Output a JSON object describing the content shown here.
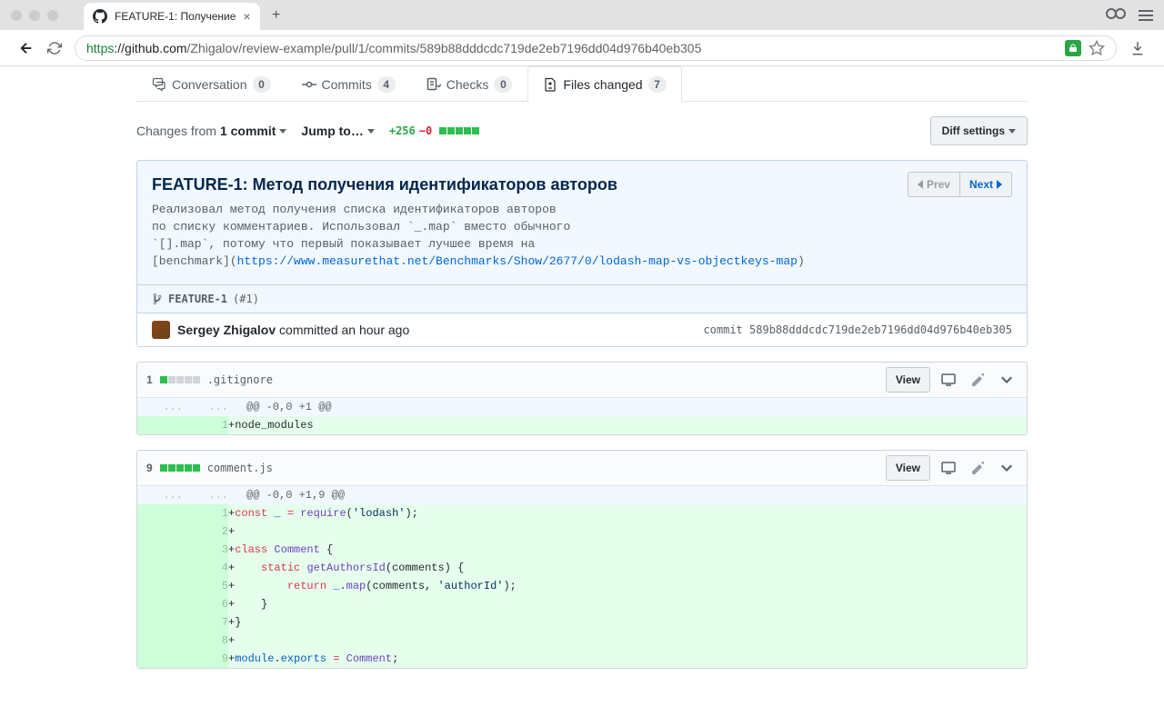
{
  "browser": {
    "tab_title": "FEATURE-1: Получение",
    "url_https": "https",
    "url_host": "://github.com",
    "url_path": "/Zhigalov/review-example/pull/1/commits/589b88dddcdc719de2eb7196dd04d976b40eb305"
  },
  "tabs": {
    "conversation": {
      "label": "Conversation",
      "count": "0"
    },
    "commits": {
      "label": "Commits",
      "count": "4"
    },
    "checks": {
      "label": "Checks",
      "count": "0"
    },
    "files": {
      "label": "Files changed",
      "count": "7"
    }
  },
  "toolbar": {
    "changes_from_prefix": "Changes from ",
    "changes_from_value": "1 commit",
    "jump_to": "Jump to…",
    "additions": "+256",
    "deletions": "−0",
    "diff_settings": "Diff settings"
  },
  "commit": {
    "title": "FEATURE-1: Метод получения идентификаторов авторов",
    "prev": "Prev",
    "next": "Next",
    "desc_line1": "Реализовал метод получения списка идентификаторов авторов",
    "desc_line2": "по списку комментариев. Использовал `_.map` вместо обычного",
    "desc_line3": "`[].map`, потому что первый показывает лучшее время на",
    "desc_line4_pre": "[benchmark](",
    "desc_link": "https://www.measurethat.net/Benchmarks/Show/2677/0/lodash-map-vs-objectkeys-map",
    "desc_line4_post": ")",
    "branch": "FEATURE-1",
    "branch_suffix": "(#1)",
    "author": "Sergey Zhigalov",
    "committed": " committed an hour ago",
    "sha_label": "commit ",
    "sha": "589b88dddcdc719de2eb7196dd04d976b40eb305"
  },
  "files": [
    {
      "count": "1",
      "blocks_added": 1,
      "name": ".gitignore",
      "view": "View",
      "hunk": "@@ -0,0 +1 @@",
      "lines": [
        {
          "n": "1",
          "html": "+node_modules"
        }
      ]
    },
    {
      "count": "9",
      "blocks_added": 5,
      "name": "comment.js",
      "view": "View",
      "hunk": "@@ -0,0 +1,9 @@",
      "lines": [
        {
          "n": "1",
          "html": "+<span class=\"pl-k\">const</span> <span class=\"pl-c1\">_</span> <span class=\"pl-k\">=</span> <span class=\"pl-en\">require</span>(<span class=\"pl-s\">'lodash'</span>);"
        },
        {
          "n": "2",
          "html": "+"
        },
        {
          "n": "3",
          "html": "+<span class=\"pl-k\">class</span> <span class=\"pl-en\">Comment</span> {"
        },
        {
          "n": "4",
          "html": "+    <span class=\"pl-k\">static</span> <span class=\"pl-en\">getAuthorsId</span>(comments) {"
        },
        {
          "n": "5",
          "html": "+        <span class=\"pl-k\">return</span> <span class=\"pl-c1\">_</span>.<span class=\"pl-en\">map</span>(comments, <span class=\"pl-s\">'authorId'</span>);"
        },
        {
          "n": "6",
          "html": "+    }"
        },
        {
          "n": "7",
          "html": "+}"
        },
        {
          "n": "8",
          "html": "+"
        },
        {
          "n": "9",
          "html": "+<span class=\"pl-c1\">module</span>.<span class=\"pl-c1\">exports</span> <span class=\"pl-k\">=</span> <span class=\"pl-en\">Comment</span>;"
        }
      ]
    }
  ]
}
